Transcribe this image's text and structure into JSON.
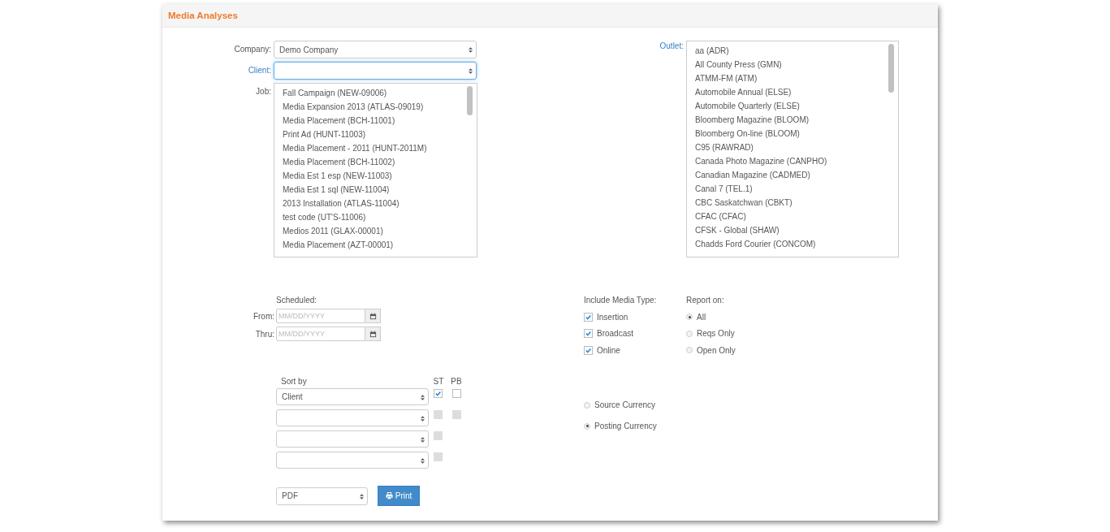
{
  "title": "Media Analyses",
  "company": {
    "label": "Company:",
    "value": "Demo Company",
    "required": false,
    "focused": false
  },
  "client": {
    "label": "Client:",
    "required": true,
    "focused": true
  },
  "job": {
    "label": "Job:",
    "required": false,
    "items": [
      "Fall Campaign (NEW-09006)",
      "Media Expansion 2013 (ATLAS-09019)",
      "Media Placement (BCH-11001)",
      "Print Ad (HUNT-11003)",
      "Media Placement - 2011 (HUNT-2011M)",
      "Media Placement (BCH-11002)",
      "Media Est 1 esp (NEW-11003)",
      "Media Est 1 sql (NEW-11004)",
      "2013 Installation (ATLAS-11004)",
      "test code (UT'S-11006)",
      "Medios 2011 (GLAX-00001)",
      "Media Placement (AZT-00001)"
    ]
  },
  "outlet": {
    "label": "Outlet:",
    "required": true,
    "items": [
      "aa (ADR)",
      "All County Press (GMN)",
      "ATMM-FM (ATM)",
      "Automobile Annual (ELSE)",
      "Automobile Quarterly (ELSE)",
      "Bloomberg Magazine (BLOOM)",
      "Bloomberg On-line (BLOOM)",
      "C95 (RAWRAD)",
      "Canada Photo Magazine (CANPHO)",
      "Canadian Magazine (CADMED)",
      "Canal 7 (TEL.1)",
      "CBC Saskatchwan (CBKT)",
      "CFAC (CFAC)",
      "CFSK - Global (SHAW)",
      "Chadds Ford Courier (CONCOM)"
    ]
  },
  "scheduled": {
    "label": "Scheduled:",
    "from": {
      "label": "From:",
      "placeholder": "MM/DD/YYYY"
    },
    "thru": {
      "label": "Thru:",
      "placeholder": "MM/DD/YYYY"
    }
  },
  "media_type": {
    "label": "Include Media Type:",
    "options": [
      {
        "label": "Insertion",
        "checked": true
      },
      {
        "label": "Broadcast",
        "checked": true
      },
      {
        "label": "Online",
        "checked": true
      }
    ]
  },
  "report_on": {
    "label": "Report on:",
    "options": [
      {
        "label": "All",
        "selected": true
      },
      {
        "label": "Reqs Only",
        "selected": false
      },
      {
        "label": "Open Only",
        "selected": false
      }
    ]
  },
  "sort": {
    "label": "Sort by",
    "st_label": "ST",
    "pb_label": "PB",
    "rows": [
      {
        "value": "Client",
        "st": {
          "checked": true,
          "disabled": false
        },
        "pb": {
          "checked": false,
          "disabled": false
        }
      },
      {
        "st": {
          "checked": false,
          "disabled": true
        },
        "pb": {
          "checked": false,
          "disabled": true
        }
      },
      {
        "st": {
          "checked": false,
          "disabled": true
        }
      },
      {
        "st": {
          "checked": false,
          "disabled": true
        }
      }
    ]
  },
  "currency": {
    "options": [
      {
        "label": "Source Currency",
        "selected": false
      },
      {
        "label": "Posting Currency",
        "selected": true
      }
    ]
  },
  "format": {
    "value": "PDF"
  },
  "print_button": {
    "label": "Print"
  }
}
